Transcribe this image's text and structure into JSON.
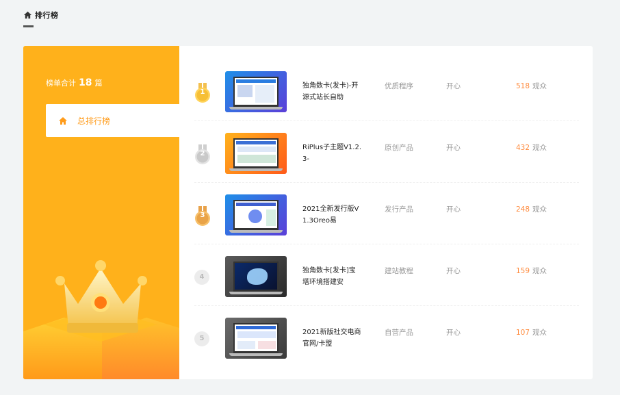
{
  "header": {
    "title": "排行榜",
    "icon": "home-icon"
  },
  "sidebar": {
    "total_label": "榜单合计",
    "total_count": "18",
    "total_unit": "篇",
    "menu": [
      {
        "label": "总排行榜",
        "icon": "home-icon",
        "active": true
      }
    ],
    "accent": "#ffb11b",
    "active_color": "#ff9c1c"
  },
  "views_unit": "观众",
  "items": [
    {
      "rank": "1",
      "badge": "gold",
      "title": "独角数卡(发卡)-开源式站长自助",
      "category": "优质程序",
      "author": "开心",
      "views": "518",
      "thumb": "blue"
    },
    {
      "rank": "2",
      "badge": "silver",
      "title": "RiPlus子主题V1.2.3-",
      "category": "原创产品",
      "author": "开心",
      "views": "432",
      "thumb": "orange"
    },
    {
      "rank": "3",
      "badge": "bronze",
      "title": "2021全新发行版V1.3Oreo易",
      "category": "发行产品",
      "author": "开心",
      "views": "248",
      "thumb": "blue"
    },
    {
      "rank": "4",
      "badge": "plain",
      "title": "独角数卡[发卡]宝塔环境搭建安",
      "category": "建站教程",
      "author": "开心",
      "views": "159",
      "thumb": "dark"
    },
    {
      "rank": "5",
      "badge": "plain",
      "title": "2021新版社交电商官网/卡盟",
      "category": "自营产品",
      "author": "开心",
      "views": "107",
      "thumb": "gray"
    }
  ]
}
